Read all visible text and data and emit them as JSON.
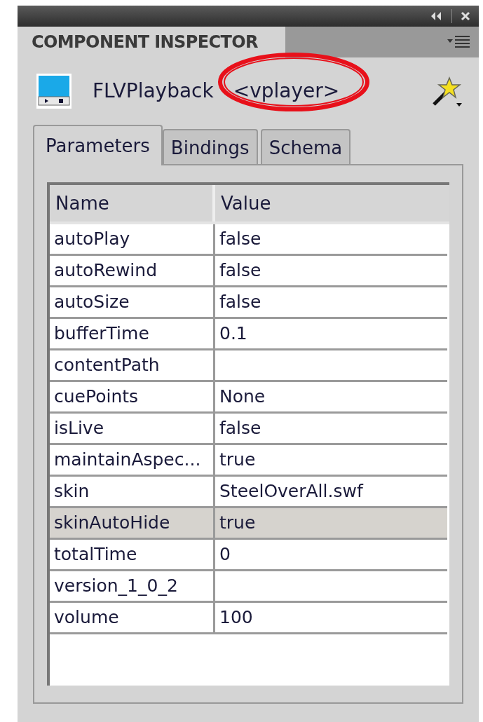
{
  "panel": {
    "title": "COMPONENT INSPECTOR"
  },
  "component": {
    "type": "FLVPlayback",
    "instance": "<vplayer>",
    "highlighted": true
  },
  "tabs": [
    {
      "label": "Parameters",
      "selected": true
    },
    {
      "label": "Bindings",
      "selected": false
    },
    {
      "label": "Schema",
      "selected": false
    }
  ],
  "table": {
    "columns": [
      "Name",
      "Value"
    ],
    "rows": [
      {
        "name": "autoPlay",
        "value": "false",
        "selected": false
      },
      {
        "name": "autoRewind",
        "value": "false",
        "selected": false
      },
      {
        "name": "autoSize",
        "value": "false",
        "selected": false
      },
      {
        "name": "bufferTime",
        "value": "0.1",
        "selected": false
      },
      {
        "name": "contentPath",
        "selected": false
      },
      {
        "name": "cuePoints",
        "value": "None",
        "selected": false
      },
      {
        "name": "isLive",
        "value": "false",
        "selected": false
      },
      {
        "name": "maintainAspec...",
        "value": "true",
        "selected": false
      },
      {
        "name": "skin",
        "value": "SteelOverAll.swf",
        "selected": false
      },
      {
        "name": "skinAutoHide",
        "value": "true",
        "selected": true
      },
      {
        "name": "totalTime",
        "value": "0",
        "selected": false
      },
      {
        "name": "version_1_0_2",
        "selected": false
      },
      {
        "name": "volume",
        "value": "100",
        "selected": false
      }
    ]
  }
}
